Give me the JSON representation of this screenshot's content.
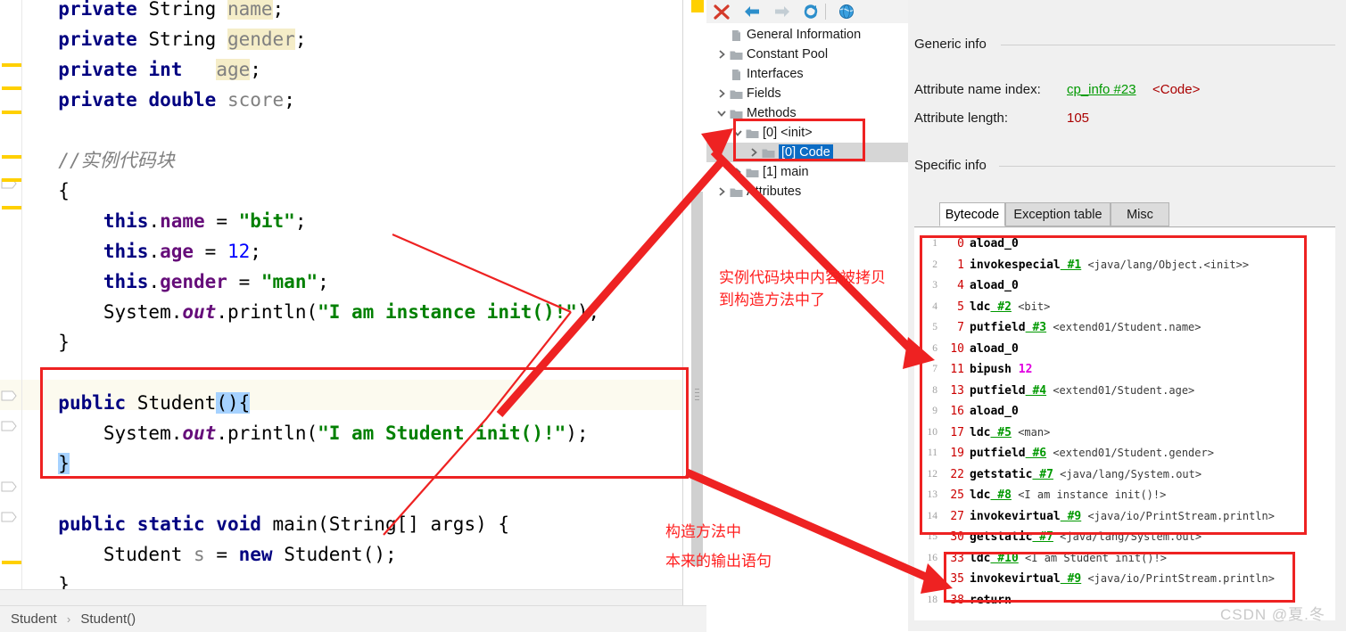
{
  "editor": {
    "lines": [
      {
        "indent": 1,
        "tokens": [
          {
            "t": "private",
            "c": "kw"
          },
          {
            "t": " String ",
            "c": "plain"
          },
          {
            "t": "name",
            "c": "fldhl"
          },
          {
            "t": ";",
            "c": "plain"
          }
        ]
      },
      {
        "indent": 1,
        "tokens": [
          {
            "t": "private",
            "c": "kw"
          },
          {
            "t": " String ",
            "c": "plain"
          },
          {
            "t": "gender",
            "c": "fldhl"
          },
          {
            "t": ";",
            "c": "plain"
          }
        ]
      },
      {
        "indent": 1,
        "tokens": [
          {
            "t": "private",
            "c": "kw"
          },
          {
            "t": " int   ",
            "c": "kw"
          },
          {
            "t": "age",
            "c": "fldhl"
          },
          {
            "t": ";",
            "c": "plain"
          }
        ]
      },
      {
        "indent": 1,
        "tokens": [
          {
            "t": "private",
            "c": "kw"
          },
          {
            "t": " double ",
            "c": "kw"
          },
          {
            "t": "score",
            "c": "fld"
          },
          {
            "t": ";",
            "c": "plain"
          }
        ]
      },
      {
        "indent": 0,
        "tokens": []
      },
      {
        "indent": 1,
        "tokens": [
          {
            "t": "//实例代码块",
            "c": "cmt"
          }
        ]
      },
      {
        "indent": 1,
        "tokens": [
          {
            "t": "{",
            "c": "plain"
          }
        ]
      },
      {
        "indent": 2,
        "tokens": [
          {
            "t": "this",
            "c": "kw"
          },
          {
            "t": ".",
            "c": "plain"
          },
          {
            "t": "name",
            "c": "fldpurple"
          },
          {
            "t": " = ",
            "c": "plain"
          },
          {
            "t": "\"bit\"",
            "c": "str"
          },
          {
            "t": ";",
            "c": "plain"
          }
        ]
      },
      {
        "indent": 2,
        "tokens": [
          {
            "t": "this",
            "c": "kw"
          },
          {
            "t": ".",
            "c": "plain"
          },
          {
            "t": "age",
            "c": "fldpurple"
          },
          {
            "t": " = ",
            "c": "plain"
          },
          {
            "t": "12",
            "c": "num"
          },
          {
            "t": ";",
            "c": "plain"
          }
        ]
      },
      {
        "indent": 2,
        "tokens": [
          {
            "t": "this",
            "c": "kw"
          },
          {
            "t": ".",
            "c": "plain"
          },
          {
            "t": "gender",
            "c": "fldpurple"
          },
          {
            "t": " = ",
            "c": "plain"
          },
          {
            "t": "\"man\"",
            "c": "str"
          },
          {
            "t": ";",
            "c": "plain"
          }
        ]
      },
      {
        "indent": 2,
        "tokens": [
          {
            "t": "System.",
            "c": "plain"
          },
          {
            "t": "out",
            "c": "stat"
          },
          {
            "t": ".println(",
            "c": "plain"
          },
          {
            "t": "\"I am instance init()!\"",
            "c": "str"
          },
          {
            "t": ");",
            "c": "plain"
          }
        ]
      },
      {
        "indent": 1,
        "tokens": [
          {
            "t": "}",
            "c": "plain"
          }
        ]
      },
      {
        "indent": 0,
        "tokens": []
      },
      {
        "indent": 1,
        "tokens": [
          {
            "t": "public",
            "c": "kw"
          },
          {
            "t": " Student",
            "c": "plain"
          },
          {
            "t": "(){",
            "c": "sel"
          }
        ]
      },
      {
        "indent": 2,
        "tokens": [
          {
            "t": "System.",
            "c": "plain"
          },
          {
            "t": "out",
            "c": "stat"
          },
          {
            "t": ".println(",
            "c": "plain"
          },
          {
            "t": "\"I am Student init()!\"",
            "c": "str"
          },
          {
            "t": ");",
            "c": "plain"
          }
        ]
      },
      {
        "indent": 1,
        "tokens": [
          {
            "t": "}",
            "c": "sel"
          }
        ]
      },
      {
        "indent": 0,
        "tokens": []
      },
      {
        "indent": 1,
        "tokens": [
          {
            "t": "public static void",
            "c": "kw"
          },
          {
            "t": " main(String[] args) {",
            "c": "plain"
          }
        ]
      },
      {
        "indent": 2,
        "tokens": [
          {
            "t": "Student ",
            "c": "plain"
          },
          {
            "t": "s",
            "c": "fld"
          },
          {
            "t": " = ",
            "c": "plain"
          },
          {
            "t": "new",
            "c": "kw"
          },
          {
            "t": " Student();",
            "c": "plain"
          }
        ]
      },
      {
        "indent": 1,
        "tokens": [
          {
            "t": "}",
            "c": "plain"
          }
        ]
      },
      {
        "indent": 0,
        "tokens": [
          {
            "t": "}",
            "c": "plain"
          }
        ]
      }
    ],
    "breadcrumb": {
      "class": "Student",
      "member": "Student()",
      "separator": "›"
    }
  },
  "tree": {
    "toolbar": [
      {
        "name": "close-icon",
        "glyph": "✕",
        "color": "#d43a2a"
      },
      {
        "name": "back-arrow-icon",
        "glyph": "⇐",
        "color": "#2c8ecb"
      },
      {
        "name": "forward-arrow-icon",
        "glyph": "⇒",
        "color": "#c3cdd4"
      },
      {
        "name": "reload-icon",
        "glyph": "↻",
        "color": "#2c8ecb"
      },
      {
        "name": "browse-globe-icon",
        "glyph": "●",
        "color": "#2f8fd4"
      }
    ],
    "nodes": [
      {
        "label": "General Information",
        "icon": "file",
        "depth": 1,
        "twisty": ""
      },
      {
        "label": "Constant Pool",
        "icon": "folder",
        "depth": 1,
        "twisty": "collapsed"
      },
      {
        "label": "Interfaces",
        "icon": "file",
        "depth": 1,
        "twisty": ""
      },
      {
        "label": "Fields",
        "icon": "folder",
        "depth": 1,
        "twisty": "collapsed"
      },
      {
        "label": "Methods",
        "icon": "folder",
        "depth": 1,
        "twisty": "expanded"
      },
      {
        "label": "[0] <init>",
        "icon": "folder",
        "depth": 2,
        "twisty": "expanded"
      },
      {
        "label": "[0] Code",
        "icon": "folder",
        "depth": 3,
        "twisty": "collapsed",
        "selected": true
      },
      {
        "label": "[1] main",
        "icon": "folder",
        "depth": 2,
        "twisty": "collapsed"
      },
      {
        "label": "Attributes",
        "icon": "folder",
        "depth": 1,
        "twisty": "collapsed"
      }
    ]
  },
  "detail": {
    "generic_title": "Generic info",
    "attr_name_label": "Attribute name index:",
    "attr_name_link": "cp_info #23",
    "attr_name_value": "<Code>",
    "attr_len_label": "Attribute length:",
    "attr_len_value": "105",
    "specific_title": "Specific info",
    "tabs": [
      {
        "label": "Bytecode",
        "active": true
      },
      {
        "label": "Exception table",
        "active": false
      },
      {
        "label": "Misc",
        "active": false
      }
    ],
    "bytecode": [
      {
        "line": "1",
        "offset": "0",
        "mnemonic": "aload_0",
        "cp": "",
        "comment": "",
        "imm": ""
      },
      {
        "line": "2",
        "offset": "1",
        "mnemonic": "invokespecial",
        "cp": "#1",
        "comment": "<java/lang/Object.<init>>",
        "imm": ""
      },
      {
        "line": "3",
        "offset": "4",
        "mnemonic": "aload_0",
        "cp": "",
        "comment": "",
        "imm": ""
      },
      {
        "line": "4",
        "offset": "5",
        "mnemonic": "ldc",
        "cp": "#2",
        "comment": "<bit>",
        "imm": ""
      },
      {
        "line": "5",
        "offset": "7",
        "mnemonic": "putfield",
        "cp": "#3",
        "comment": "<extend01/Student.name>",
        "imm": ""
      },
      {
        "line": "6",
        "offset": "10",
        "mnemonic": "aload_0",
        "cp": "",
        "comment": "",
        "imm": ""
      },
      {
        "line": "7",
        "offset": "11",
        "mnemonic": "bipush",
        "cp": "",
        "comment": "",
        "imm": "12"
      },
      {
        "line": "8",
        "offset": "13",
        "mnemonic": "putfield",
        "cp": "#4",
        "comment": "<extend01/Student.age>",
        "imm": ""
      },
      {
        "line": "9",
        "offset": "16",
        "mnemonic": "aload_0",
        "cp": "",
        "comment": "",
        "imm": ""
      },
      {
        "line": "10",
        "offset": "17",
        "mnemonic": "ldc",
        "cp": "#5",
        "comment": "<man>",
        "imm": ""
      },
      {
        "line": "11",
        "offset": "19",
        "mnemonic": "putfield",
        "cp": "#6",
        "comment": "<extend01/Student.gender>",
        "imm": ""
      },
      {
        "line": "12",
        "offset": "22",
        "mnemonic": "getstatic",
        "cp": "#7",
        "comment": "<java/lang/System.out>",
        "imm": ""
      },
      {
        "line": "13",
        "offset": "25",
        "mnemonic": "ldc",
        "cp": "#8",
        "comment": "<I am instance init()!>",
        "imm": ""
      },
      {
        "line": "14",
        "offset": "27",
        "mnemonic": "invokevirtual",
        "cp": "#9",
        "comment": "<java/io/PrintStream.println>",
        "imm": ""
      },
      {
        "line": "15",
        "offset": "30",
        "mnemonic": "getstatic",
        "cp": "#7",
        "comment": "<java/lang/System.out>",
        "imm": ""
      },
      {
        "line": "16",
        "offset": "33",
        "mnemonic": "ldc",
        "cp": "#10",
        "comment": "<I am Student init()!>",
        "imm": ""
      },
      {
        "line": "17",
        "offset": "35",
        "mnemonic": "invokevirtual",
        "cp": "#9",
        "comment": "<java/io/PrintStream.println>",
        "imm": ""
      },
      {
        "line": "18",
        "offset": "38",
        "mnemonic": "return",
        "cp": "",
        "comment": "",
        "imm": ""
      }
    ]
  },
  "annotations": {
    "note_top_line1": "实例代码块中内容被拷贝",
    "note_top_line2": "到构造方法中了",
    "note_bottom_line1": "构造方法中",
    "note_bottom_line2": "本来的输出语句"
  },
  "watermark": "CSDN @夏.冬",
  "colors": {
    "annotation_red": "#ff2020",
    "box_red": "#ee2222",
    "selection_blue": "#a6d2ff",
    "tree_select_blue": "#0c6cc4",
    "marker_yellow": "#ffd000"
  }
}
